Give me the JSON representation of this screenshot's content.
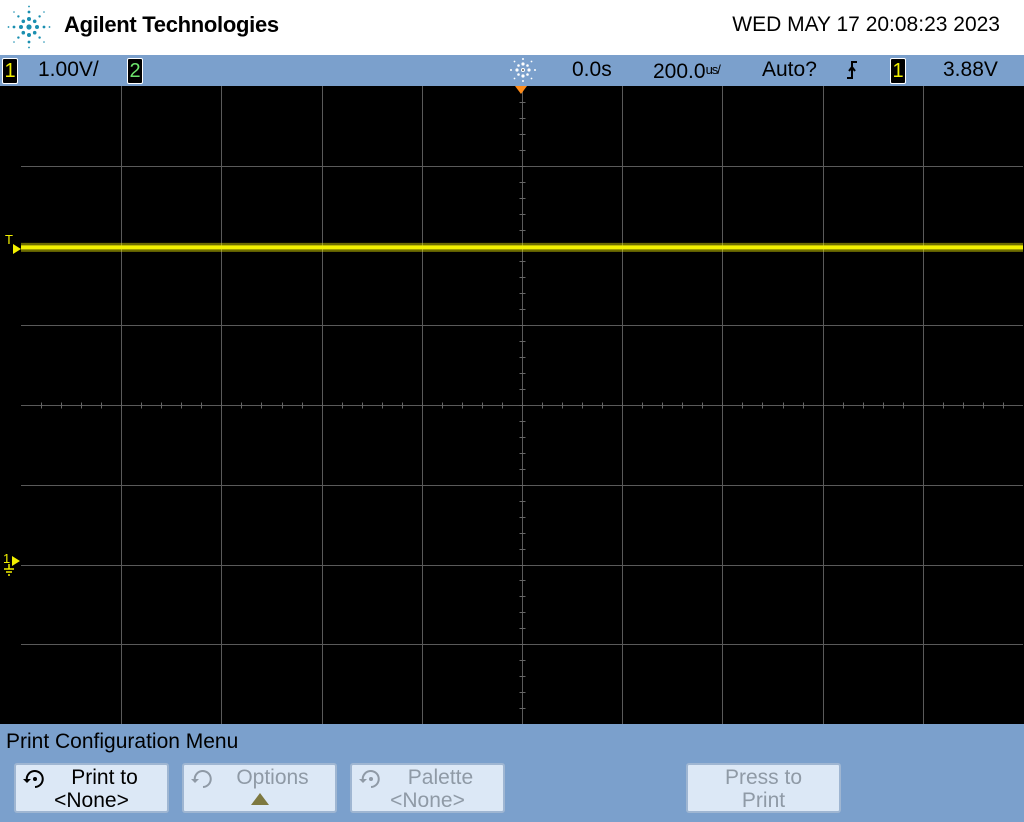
{
  "header": {
    "brand": "Agilent Technologies",
    "datetime": "WED MAY 17 20:08:23 2023"
  },
  "status": {
    "ch1_number": "1",
    "ch1_scale": "1.00V/",
    "ch2_number": "2",
    "run_state_icon": "acquisition-run-icon",
    "time_delay": "0.0s",
    "timebase": "200.0",
    "timebase_unit": "us/",
    "trigger_mode": "Auto?",
    "trigger_slope": "ƒ",
    "trigger_source": "1",
    "trigger_level": "3.88V"
  },
  "screen": {
    "trigger_marker": "T",
    "ch1_ground_marker": "1",
    "trace_color": "#f2f000",
    "trace_level_fraction_from_top": 0.253
  },
  "menu": {
    "title": "Print Configuration Menu",
    "softkeys": [
      {
        "line1": "Print to",
        "line2": "<None>",
        "enabled": true,
        "icon": "rotate-knob-icon"
      },
      {
        "line1": "Options",
        "line2": "▲",
        "enabled": false,
        "icon": "rotate-knob-icon"
      },
      {
        "line1": "Palette",
        "line2": "<None>",
        "enabled": false,
        "icon": "rotate-knob-icon"
      },
      {
        "line1": "Press to",
        "line2": "Print",
        "enabled": false
      }
    ]
  },
  "colors": {
    "ch1": "#f2f000",
    "ch2": "#6ce36c",
    "bar": "#7ba0cc",
    "trigger_pointer": "#ff8c1a",
    "grid": "#5a5a5a"
  }
}
